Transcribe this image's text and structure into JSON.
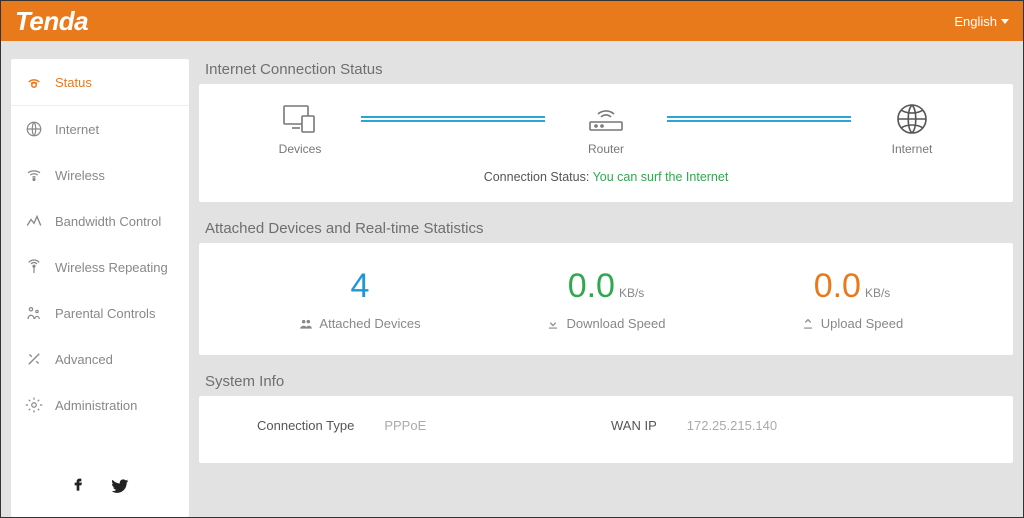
{
  "header": {
    "brand": "Tenda",
    "language": "English"
  },
  "sidebar": {
    "items": [
      {
        "label": "Status"
      },
      {
        "label": "Internet"
      },
      {
        "label": "Wireless"
      },
      {
        "label": "Bandwidth Control"
      },
      {
        "label": "Wireless Repeating"
      },
      {
        "label": "Parental Controls"
      },
      {
        "label": "Advanced"
      },
      {
        "label": "Administration"
      }
    ]
  },
  "connection": {
    "title": "Internet Connection Status",
    "nodes": {
      "devices": "Devices",
      "router": "Router",
      "internet": "Internet"
    },
    "status_label": "Connection Status:",
    "status_text": "You can surf the Internet"
  },
  "stats": {
    "title": "Attached Devices and Real-time Statistics",
    "attached": {
      "value": "4",
      "label": "Attached Devices"
    },
    "download": {
      "value": "0.0",
      "unit": "KB/s",
      "label": "Download Speed"
    },
    "upload": {
      "value": "0.0",
      "unit": "KB/s",
      "label": "Upload Speed"
    }
  },
  "sysinfo": {
    "title": "System Info",
    "conn_type_label": "Connection Type",
    "conn_type_value": "PPPoE",
    "wan_ip_label": "WAN IP",
    "wan_ip_value": "172.25.215.140"
  }
}
